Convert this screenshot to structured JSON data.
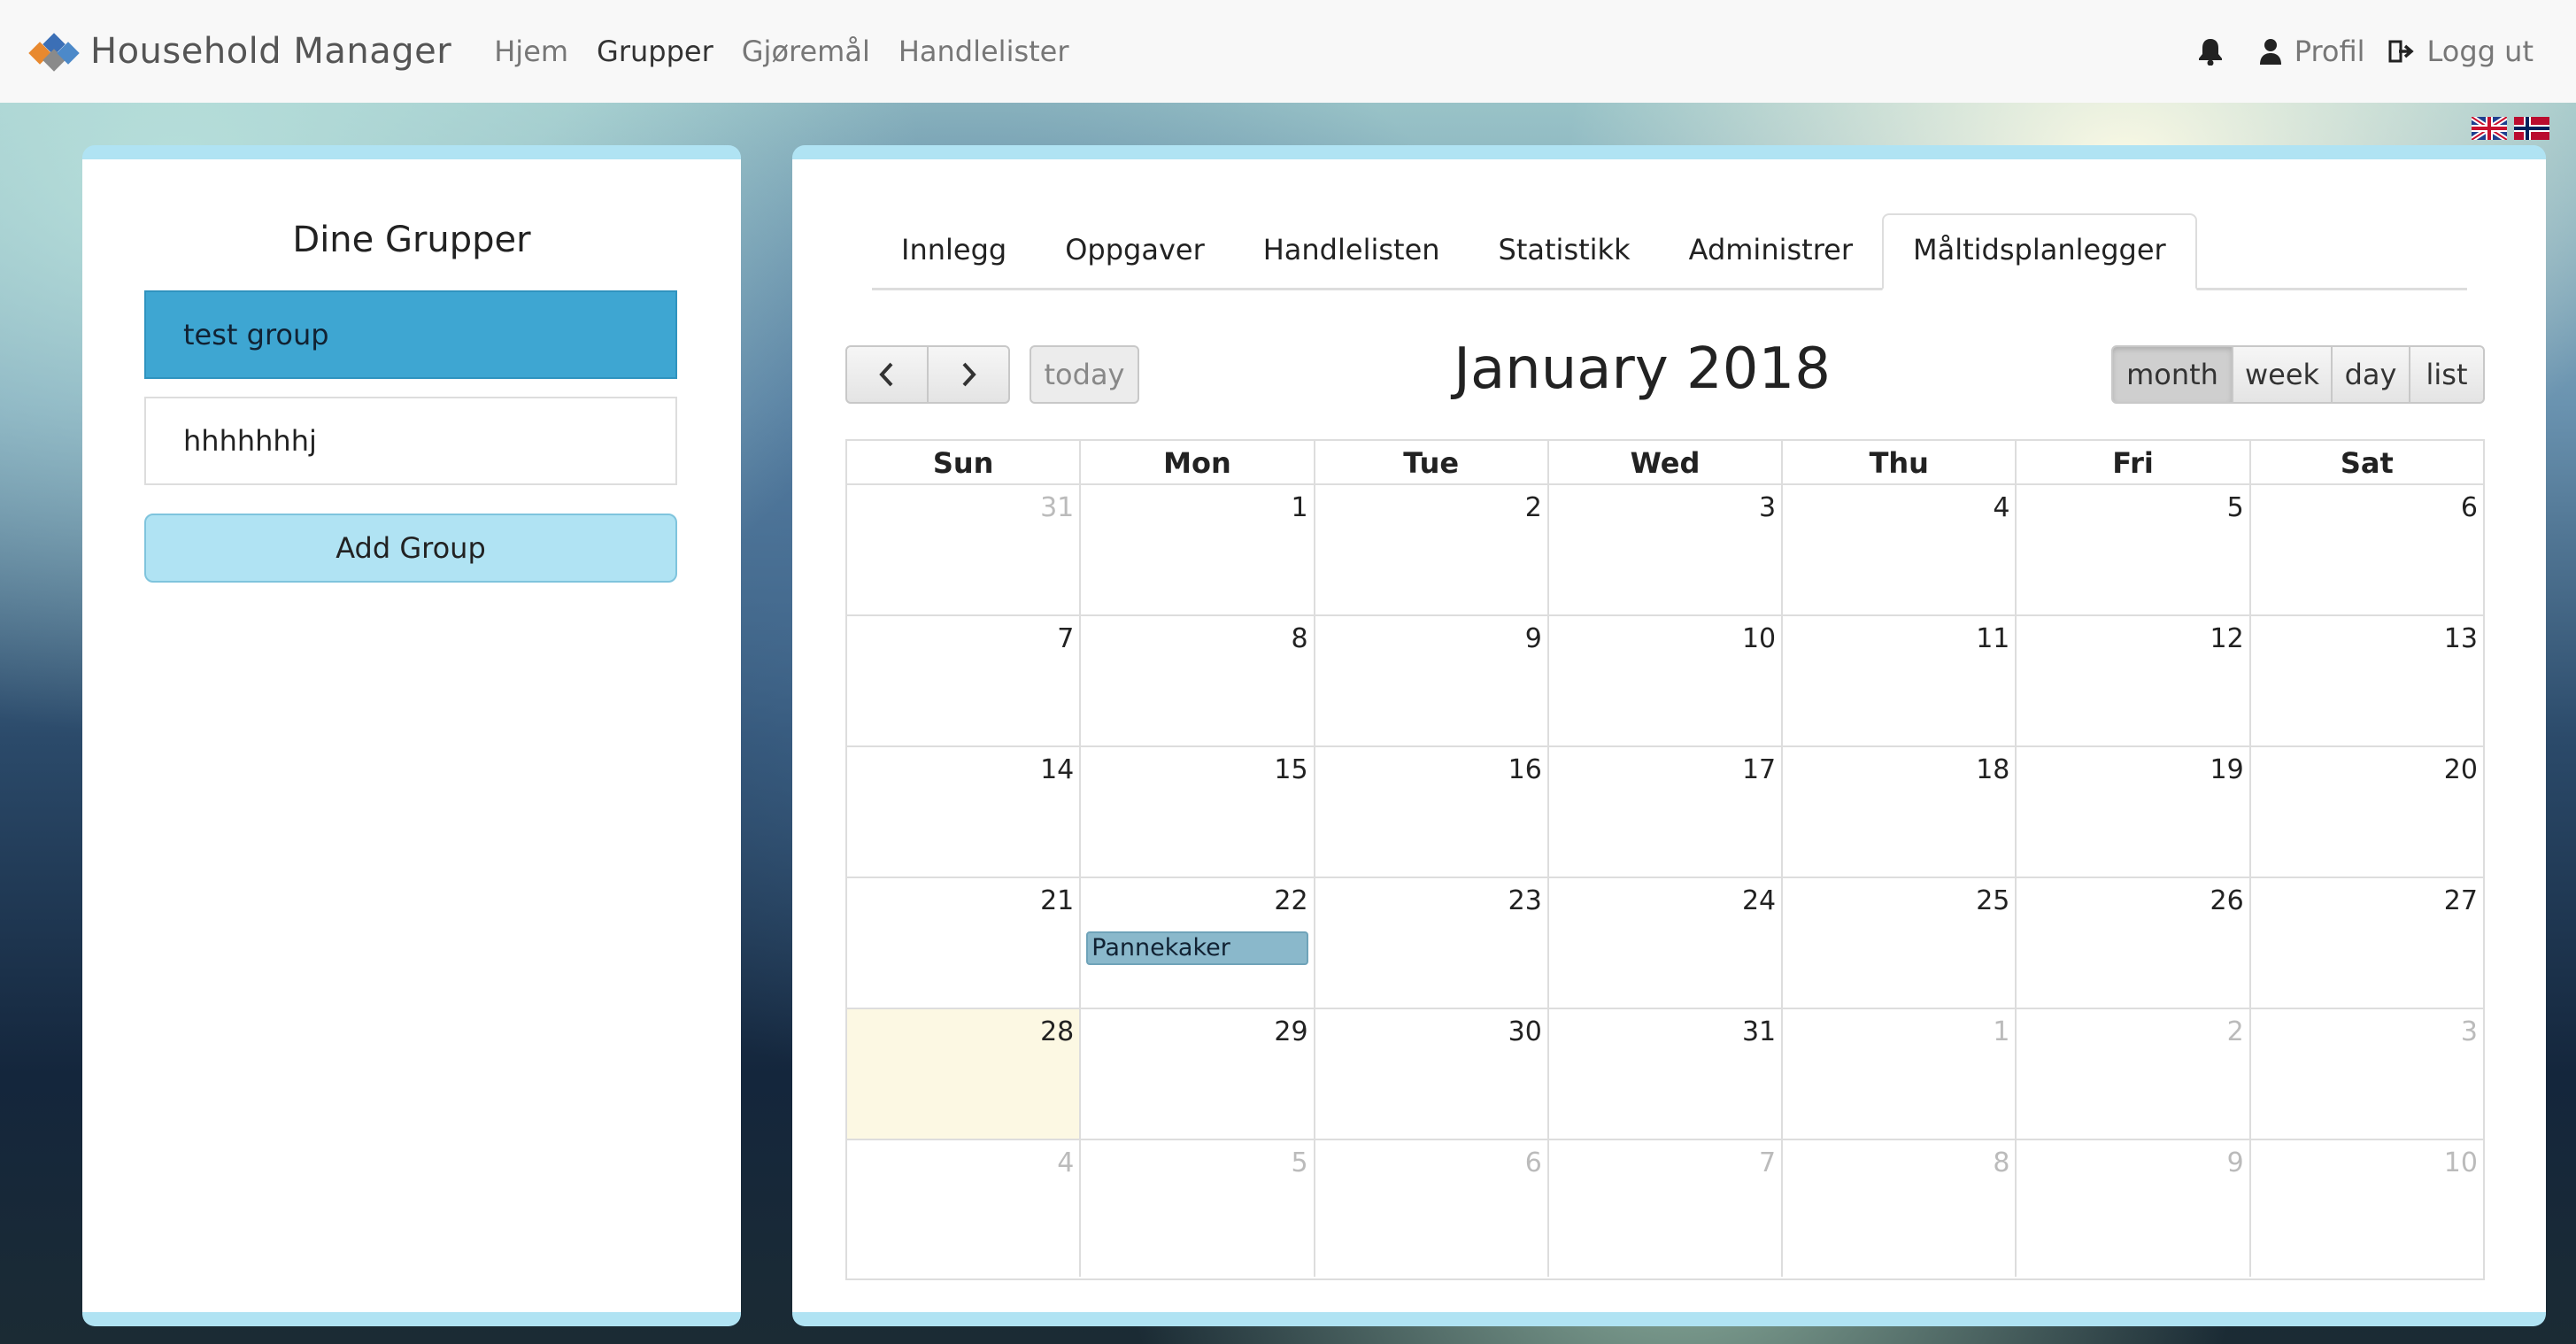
{
  "brand": {
    "name": "Household Manager"
  },
  "nav": {
    "links": [
      "Hjem",
      "Grupper",
      "Gjøremål",
      "Handlelister"
    ],
    "active_index": 1,
    "profile_label": "Profil",
    "logout_label": "Logg ut"
  },
  "languages": [
    "English",
    "Norsk"
  ],
  "groups_panel": {
    "title": "Dine Grupper",
    "groups": [
      "test group",
      "hhhhhhhj"
    ],
    "active_group": "test group",
    "add_button": "Add Group"
  },
  "tabs": {
    "items": [
      "Innlegg",
      "Oppgaver",
      "Handlelisten",
      "Statistikk",
      "Administrer",
      "Måltidsplanlegger"
    ],
    "active": "Måltidsplanlegger"
  },
  "calendar": {
    "title": "January 2018",
    "today_label": "today",
    "view_buttons": [
      "month",
      "week",
      "day",
      "list"
    ],
    "active_view": "month",
    "day_headers": [
      "Sun",
      "Mon",
      "Tue",
      "Wed",
      "Thu",
      "Fri",
      "Sat"
    ],
    "weeks": [
      [
        {
          "n": "31",
          "other": true
        },
        {
          "n": "1"
        },
        {
          "n": "2"
        },
        {
          "n": "3"
        },
        {
          "n": "4"
        },
        {
          "n": "5"
        },
        {
          "n": "6"
        }
      ],
      [
        {
          "n": "7"
        },
        {
          "n": "8"
        },
        {
          "n": "9"
        },
        {
          "n": "10"
        },
        {
          "n": "11"
        },
        {
          "n": "12"
        },
        {
          "n": "13"
        }
      ],
      [
        {
          "n": "14"
        },
        {
          "n": "15"
        },
        {
          "n": "16"
        },
        {
          "n": "17"
        },
        {
          "n": "18"
        },
        {
          "n": "19"
        },
        {
          "n": "20"
        }
      ],
      [
        {
          "n": "21"
        },
        {
          "n": "22",
          "event": "Pannekaker"
        },
        {
          "n": "23"
        },
        {
          "n": "24"
        },
        {
          "n": "25"
        },
        {
          "n": "26"
        },
        {
          "n": "27"
        }
      ],
      [
        {
          "n": "28",
          "today": true
        },
        {
          "n": "29"
        },
        {
          "n": "30"
        },
        {
          "n": "31"
        },
        {
          "n": "1",
          "other": true
        },
        {
          "n": "2",
          "other": true
        },
        {
          "n": "3",
          "other": true
        }
      ],
      [
        {
          "n": "4",
          "other": true
        },
        {
          "n": "5",
          "other": true
        },
        {
          "n": "6",
          "other": true
        },
        {
          "n": "7",
          "other": true
        },
        {
          "n": "8",
          "other": true
        },
        {
          "n": "9",
          "other": true
        },
        {
          "n": "10",
          "other": true
        }
      ]
    ]
  },
  "colors": {
    "accent_blue": "#3ea6d2",
    "light_blue": "#b0e3f3",
    "event": "#8ab8cb",
    "today_highlight": "#fcf8e3"
  }
}
